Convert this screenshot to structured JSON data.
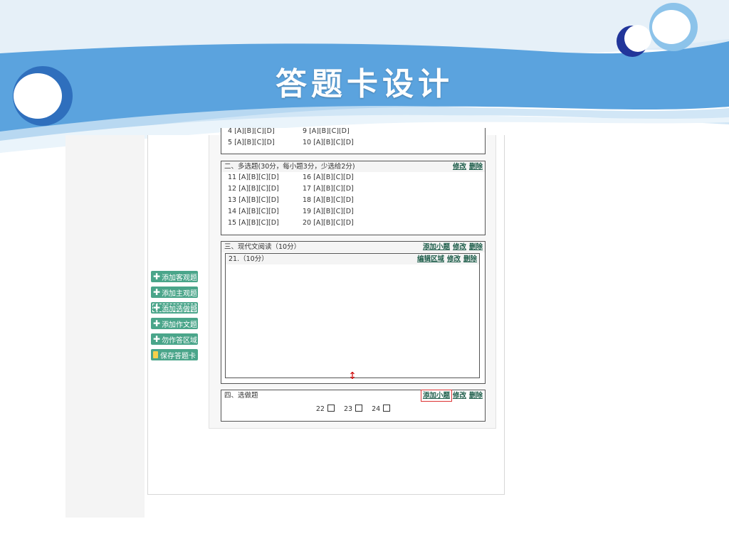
{
  "slide": {
    "title": "答题卡设计"
  },
  "sidebar": {
    "buttons": [
      {
        "label": "添加客观题",
        "icon": "plus-icon"
      },
      {
        "label": "添加主观题",
        "icon": "plus-icon"
      },
      {
        "label": "添加选做题",
        "icon": "plus-icon"
      },
      {
        "label": "添加作文题",
        "icon": "plus-icon"
      },
      {
        "label": "勿作答区域",
        "icon": "plus-icon"
      },
      {
        "label": "保存答题卡",
        "icon": "save-icon"
      }
    ]
  },
  "section1": {
    "cut_row": [
      "4 [A][B][C][D]",
      "9 [A][B][C][D]"
    ],
    "last_row": [
      "5 [A][B][C][D]",
      "10 [A][B][C][D]"
    ]
  },
  "section2": {
    "title": "二、多选题(30分，每小题3分，少选给2分)",
    "edit": "修改",
    "delete": "删除",
    "rows": [
      [
        "11 [A][B][C][D]",
        "16 [A][B][C][D]"
      ],
      [
        "12 [A][B][C][D]",
        "17 [A][B][C][D]"
      ],
      [
        "13 [A][B][C][D]",
        "18 [A][B][C][D]"
      ],
      [
        "14 [A][B][C][D]",
        "19 [A][B][C][D]"
      ],
      [
        "15 [A][B][C][D]",
        "20 [A][B][C][D]"
      ]
    ]
  },
  "section3": {
    "title": "三、现代文阅读（10分）",
    "add_sub": "添加小题",
    "edit": "修改",
    "delete": "删除",
    "sub": {
      "title": "21.（10分）",
      "edit_area": "编辑区域",
      "edit": "修改",
      "delete": "删除"
    }
  },
  "section4": {
    "title": "四、选做题",
    "add_sub": "添加小题",
    "edit": "修改",
    "delete": "删除",
    "options": [
      "22",
      "23",
      "24"
    ]
  },
  "colors": {
    "banner_blue": "#5ba3de",
    "button_green": "#4aa58a",
    "link_green": "#1d5d4a",
    "highlight_red": "#d33333"
  }
}
